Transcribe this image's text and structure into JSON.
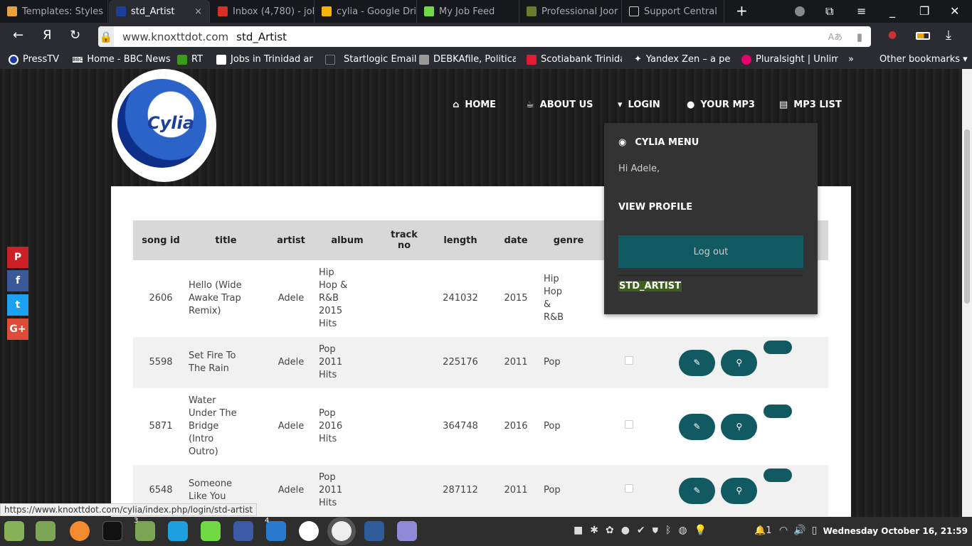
{
  "browser": {
    "tabs": [
      {
        "label": "Templates: Styles",
        "color": "#e8a33d"
      },
      {
        "label": "std_Artist",
        "color": "#1b3f9a",
        "active": true
      },
      {
        "label": "Inbox (4,780) - joh",
        "color": "#d93025"
      },
      {
        "label": "cylia - Google Dri",
        "color": "#f4b400"
      },
      {
        "label": "My Job Feed",
        "color": "#6fda44"
      },
      {
        "label": "Professional Joor",
        "color": "#6b7d2a"
      },
      {
        "label": "Support Central",
        "color": "#ffffff"
      }
    ],
    "close_tab": "×",
    "new_tab": "+",
    "url_domain": "www.knoxttdot.com",
    "url_title": "std_Artist",
    "bookmarks": [
      "PressTV",
      "Home - BBC News",
      "RT",
      "Jobs in Trinidad an",
      "Startlogic Email",
      "DEBKAfile, Politica",
      "Scotiabank Trinida",
      "Yandex Zen – a per",
      "Pluralsight | Unlim"
    ],
    "more_bookmarks": "»",
    "other_bookmarks": "Other bookmarks ▾"
  },
  "site": {
    "logo_text": "Cylia",
    "nav": [
      {
        "label": "HOME",
        "icon": "⌂"
      },
      {
        "label": "ABOUT US",
        "icon": "☕"
      },
      {
        "label": "LOGIN",
        "icon": "▾"
      },
      {
        "label": "YOUR MP3",
        "icon": ""
      },
      {
        "label": "MP3 LIST",
        "icon": "▤"
      }
    ],
    "dropdown": {
      "title": "CYLIA MENU",
      "greeting": "Hi Adele,",
      "view_profile": "VIEW PROFILE",
      "logout": "Log out",
      "role": "STD_ARTIST"
    },
    "social": [
      {
        "icon": "P",
        "color": "#cb2027"
      },
      {
        "icon": "f",
        "color": "#3b5998"
      },
      {
        "icon": "t",
        "color": "#1da1f2"
      },
      {
        "icon": "G+",
        "color": "#dd4b39"
      }
    ],
    "table": {
      "headers": [
        "song id",
        "title",
        "artist",
        "album",
        "track no",
        "length",
        "date",
        "genre"
      ],
      "rows": [
        {
          "id": "2606",
          "title": "Hello (Wide Awake Trap Remix)",
          "artist": "Adele",
          "album": "Hip Hop & R&B 2015 Hits",
          "track": "",
          "length": "241032",
          "date": "2015",
          "genre": "Hip Hop & R&B"
        },
        {
          "id": "5598",
          "title": "Set Fire To The Rain",
          "artist": "Adele",
          "album": "Pop 2011 Hits",
          "track": "",
          "length": "225176",
          "date": "2011",
          "genre": "Pop"
        },
        {
          "id": "5871",
          "title": "Water Under The Bridge (Intro Outro)",
          "artist": "Adele",
          "album": "Pop 2016 Hits",
          "track": "",
          "length": "364748",
          "date": "2016",
          "genre": "Pop"
        },
        {
          "id": "6548",
          "title": "Someone Like You",
          "artist": "Adele",
          "album": "Pop 2011 Hits",
          "track": "",
          "length": "287112",
          "date": "2011",
          "genre": "Pop"
        }
      ]
    }
  },
  "status_url": "https://www.knoxttdot.com/cylia/index.php/login/std-artist",
  "taskbar": {
    "badge_files": "3",
    "badge_docs": "4",
    "notif_count": "1",
    "clock": "Wednesday October 16, 21:59"
  }
}
